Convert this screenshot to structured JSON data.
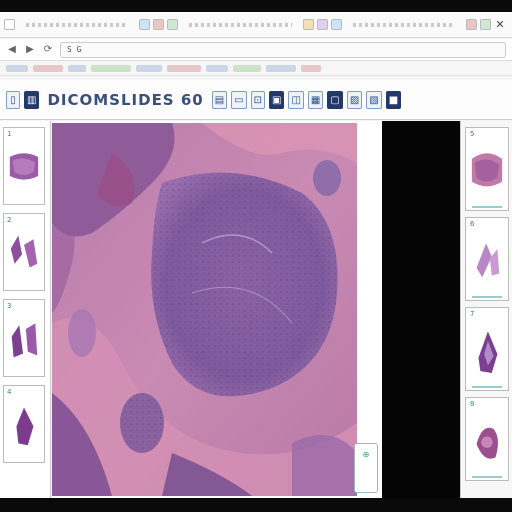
{
  "browser": {
    "close_glyph": "✕",
    "back_glyph": "◀",
    "forward_glyph": "▶",
    "reload_glyph": "⟳",
    "address": "S  G"
  },
  "viewer_toolbar": {
    "title": "DICOMSLIDES 60",
    "buttons": [
      "▯",
      "▥",
      "▤",
      "▭",
      "⊡",
      "▣",
      "◫",
      "▦",
      "▢",
      "▨",
      "▧",
      "⬚",
      "▯",
      "■"
    ]
  },
  "left_thumbnails": [
    {
      "label": "1"
    },
    {
      "label": "2"
    },
    {
      "label": "3"
    },
    {
      "label": "4"
    }
  ],
  "right_thumbnails": [
    {
      "label": "5"
    },
    {
      "label": "6"
    },
    {
      "label": "7"
    },
    {
      "label": "8"
    }
  ],
  "zoom_badge": {
    "label": "⊕"
  },
  "colors": {
    "stain_purple": "#8a5a9c",
    "stain_pink": "#d892b2",
    "accent_blue": "#23386b"
  },
  "icons": {
    "slide_viewer": "he-stained-tissue-image",
    "thumbnail": "tissue-thumbnail-icon"
  }
}
